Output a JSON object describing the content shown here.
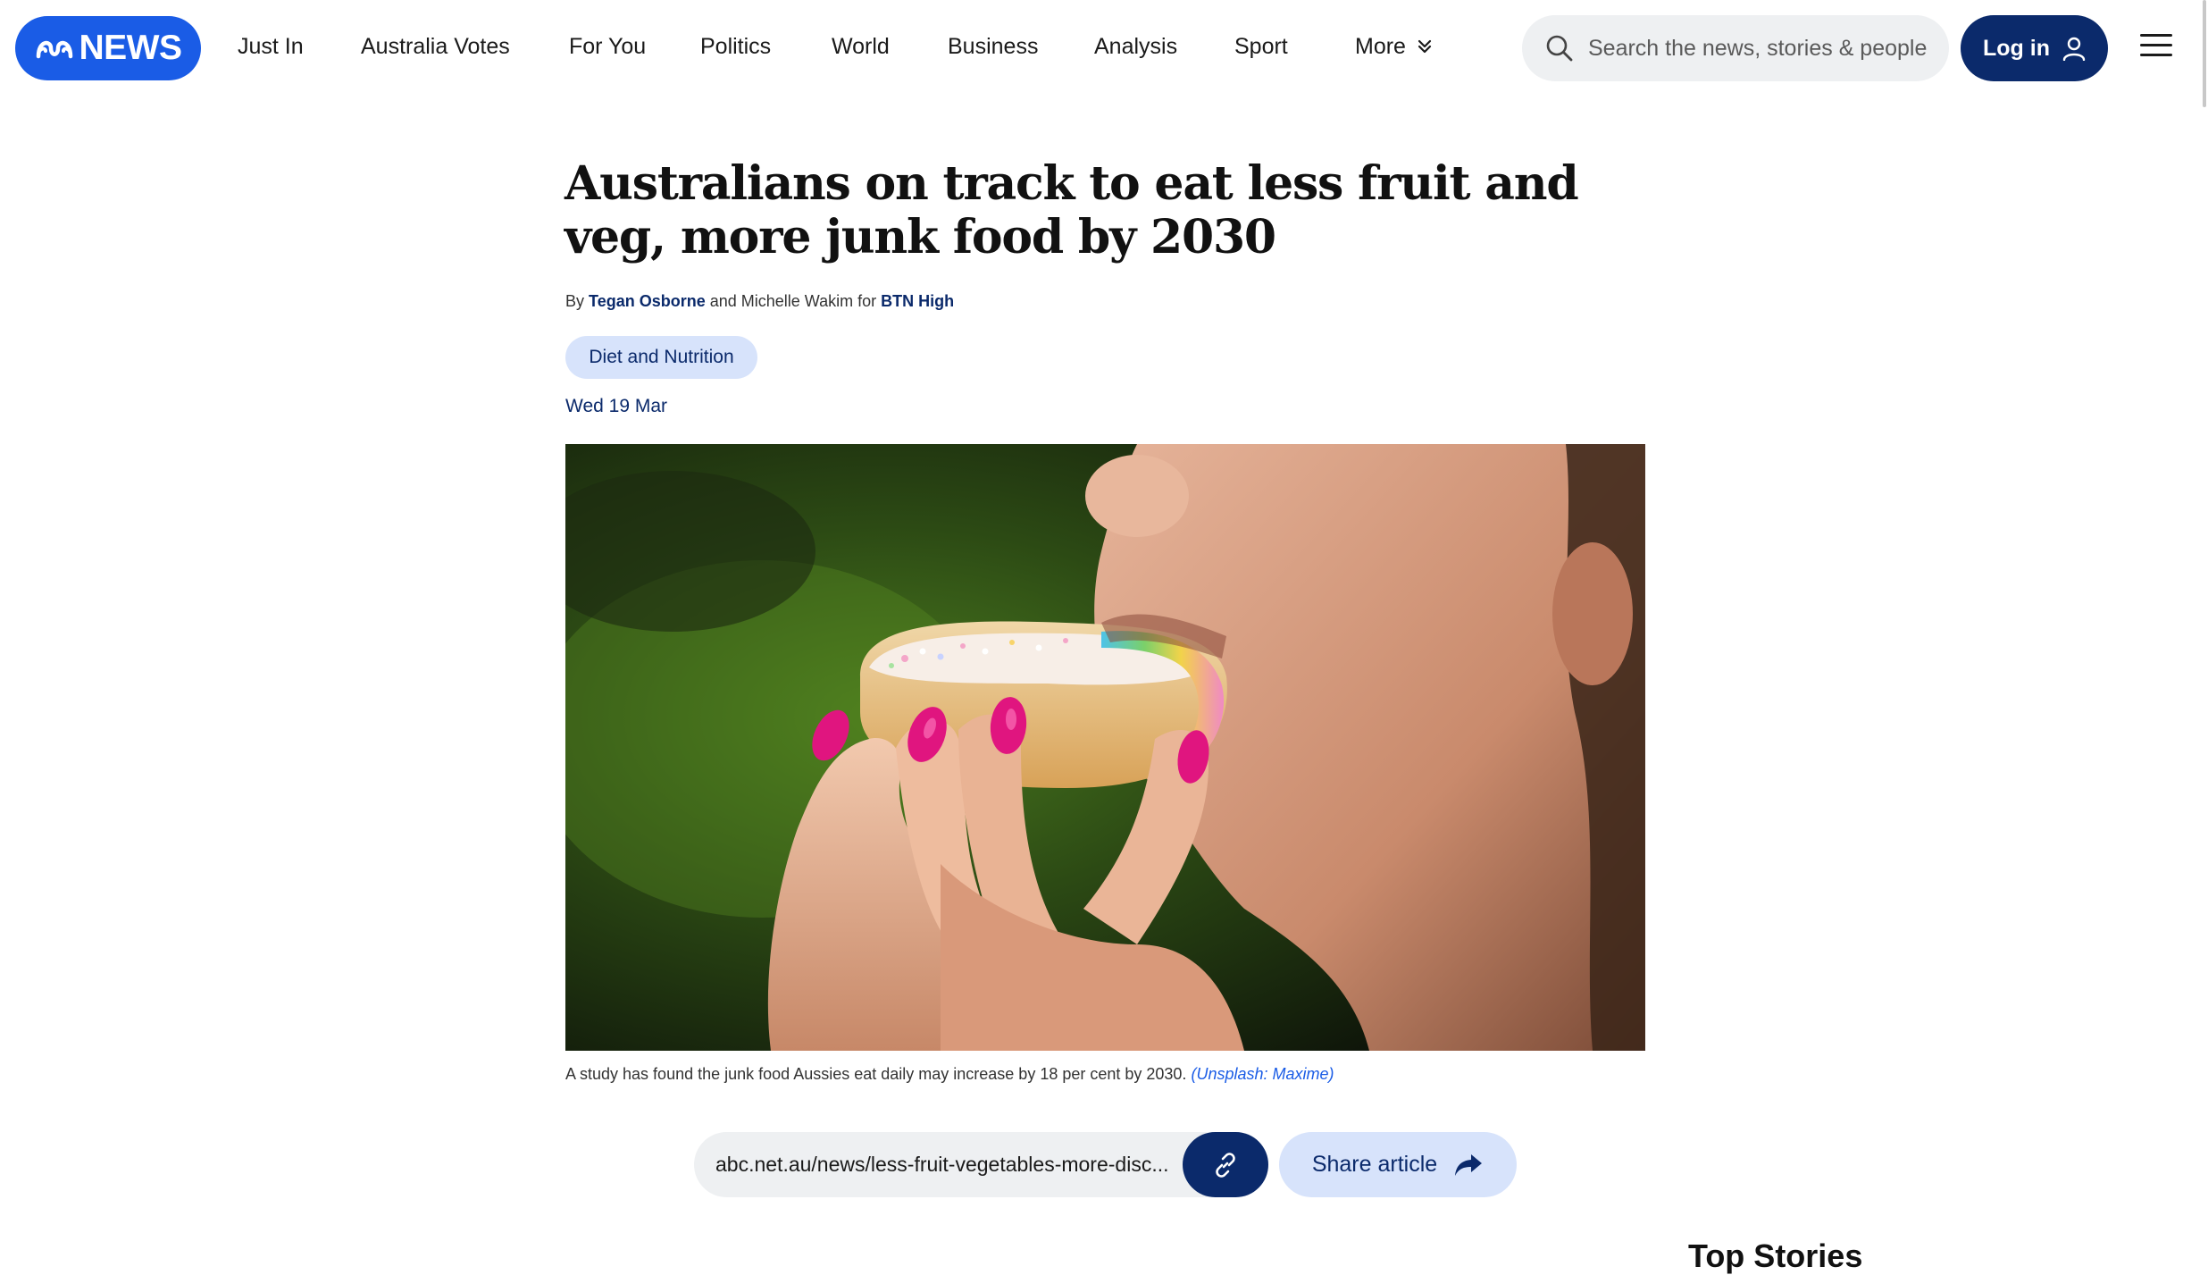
{
  "header": {
    "logo_text": "NEWS",
    "nav": [
      {
        "label": "Just In"
      },
      {
        "label": "Australia Votes"
      },
      {
        "label": "For You"
      },
      {
        "label": "Politics"
      },
      {
        "label": "World"
      },
      {
        "label": "Business"
      },
      {
        "label": "Analysis"
      },
      {
        "label": "Sport"
      },
      {
        "label": "More"
      }
    ],
    "search_placeholder": "Search the news, stories & people",
    "login_label": "Log in"
  },
  "article": {
    "headline": "Australians on track to eat less fruit and veg, more junk food by 2030",
    "byline": {
      "prefix": "By",
      "author1": "Tegan Osborne",
      "joiner": "and Michelle Wakim for",
      "program": "BTN High"
    },
    "tag": "Diet and Nutrition",
    "date": "Wed 19 Mar",
    "image": {
      "caption": "A study has found the junk food Aussies eat daily may increase by 18 per cent by 2030.",
      "credit": "(Unsplash: Maxime)"
    },
    "share": {
      "url": "abc.net.au/news/less-fruit-vegetables-more-disc...",
      "share_label": "Share article"
    }
  },
  "sidebar": {
    "title": "Top Stories"
  },
  "colors": {
    "brand_blue": "#1a5ce6",
    "navy": "#0b2a6b",
    "tag_bg": "#d7e3fb",
    "nail_pink": "#e0157f"
  }
}
